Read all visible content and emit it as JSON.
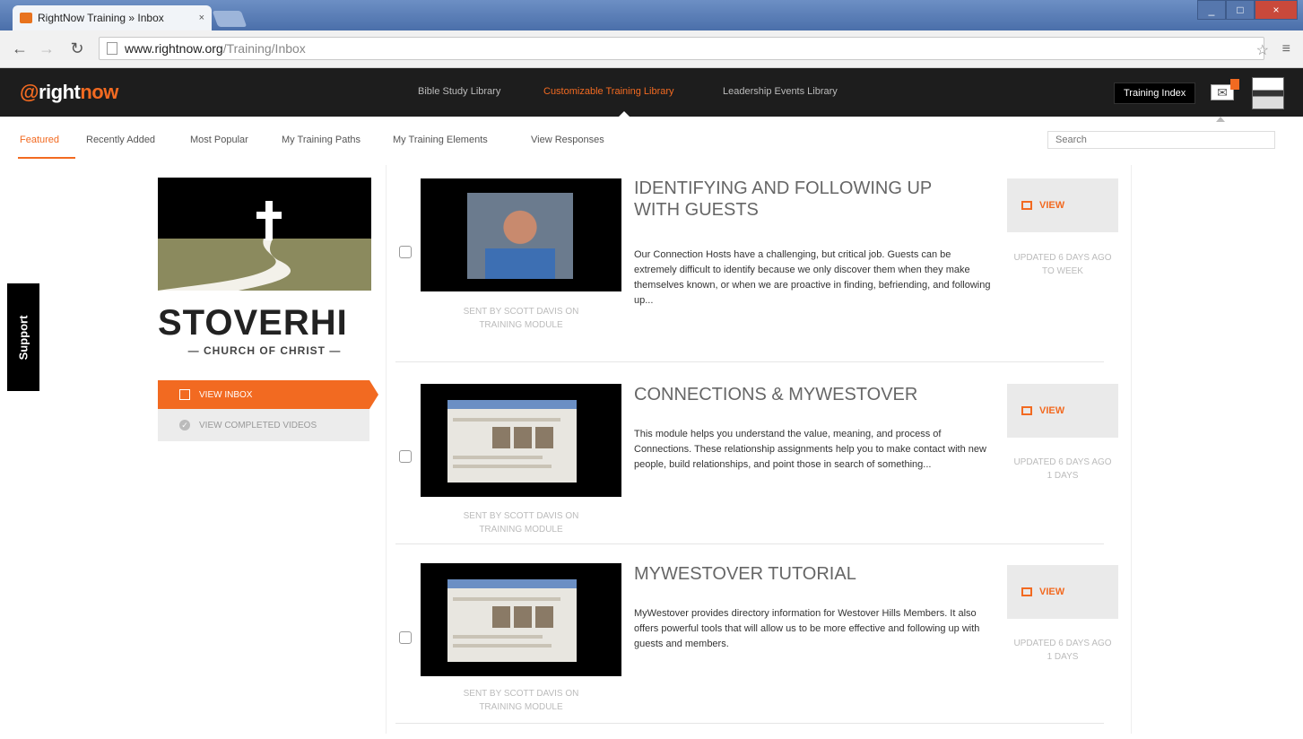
{
  "browser": {
    "tab_title": "RightNow Training » Inbox",
    "tab_close": "×",
    "url_domain": "www.rightnow.org",
    "url_path": "/Training/Inbox",
    "window_buttons": [
      "_",
      "□",
      "×"
    ]
  },
  "site": {
    "logo_at": "@",
    "logo_right": "right",
    "logo_now": "now",
    "libraries": [
      "Bible Study Library",
      "Customizable Training Library",
      "Leadership Events Library"
    ],
    "active_library": 1,
    "org_select": "Training Index",
    "mail_icon": "envelope-icon"
  },
  "subnav": {
    "items": [
      "Featured",
      "Recently Added",
      "Most Popular",
      "My Training Paths",
      "My Training Elements",
      "View Responses"
    ],
    "active": 0,
    "search_placeholder": "Search"
  },
  "support_label": "Support",
  "church": {
    "name_bold": "STOVER",
    "name_thin": "HI",
    "subtitle": "— CHURCH OF CHRIST —",
    "view_inbox": "VIEW INBOX",
    "view_completed": "VIEW COMPLETED VIDEOS"
  },
  "items": [
    {
      "title": "IDENTIFYING AND FOLLOWING UP WITH GUESTS",
      "description": "Our Connection Hosts have a challenging, but critical job. Guests can be extremely difficult to identify because we only discover them when they make themselves known, or when we are proactive in finding, befriending, and following up...",
      "meta_line1": "SENT BY SCOTT DAVIS ON",
      "meta_line2": "TRAINING MODULE",
      "view_label": "VIEW",
      "assigned_line1": "UPDATED 6 DAYS AGO",
      "assigned_line2": "TO WEEK",
      "thumb": "person"
    },
    {
      "title": "CONNECTIONS & MYWESTOVER",
      "description": "This module helps you understand the value, meaning, and process of Connections. These relationship assignments help you to make contact with new people, build relationships, and point those in search of something...",
      "meta_line1": "SENT BY SCOTT DAVIS ON",
      "meta_line2": "TRAINING MODULE",
      "view_label": "VIEW",
      "assigned_line1": "UPDATED 6 DAYS AGO",
      "assigned_line2": "1 DAYS",
      "thumb": "screen"
    },
    {
      "title": "MYWESTOVER TUTORIAL",
      "description": "MyWestover provides directory information for Westover Hills Members. It also offers powerful tools that will allow us to be more effective and following up with guests and members.",
      "meta_line1": "SENT BY SCOTT DAVIS ON",
      "meta_line2": "TRAINING MODULE",
      "view_label": "VIEW",
      "assigned_line1": "UPDATED 6 DAYS AGO",
      "assigned_line2": "1 DAYS",
      "thumb": "screen"
    }
  ],
  "colors": {
    "accent": "#f26a21",
    "nav_bg": "#1d1d1d"
  }
}
